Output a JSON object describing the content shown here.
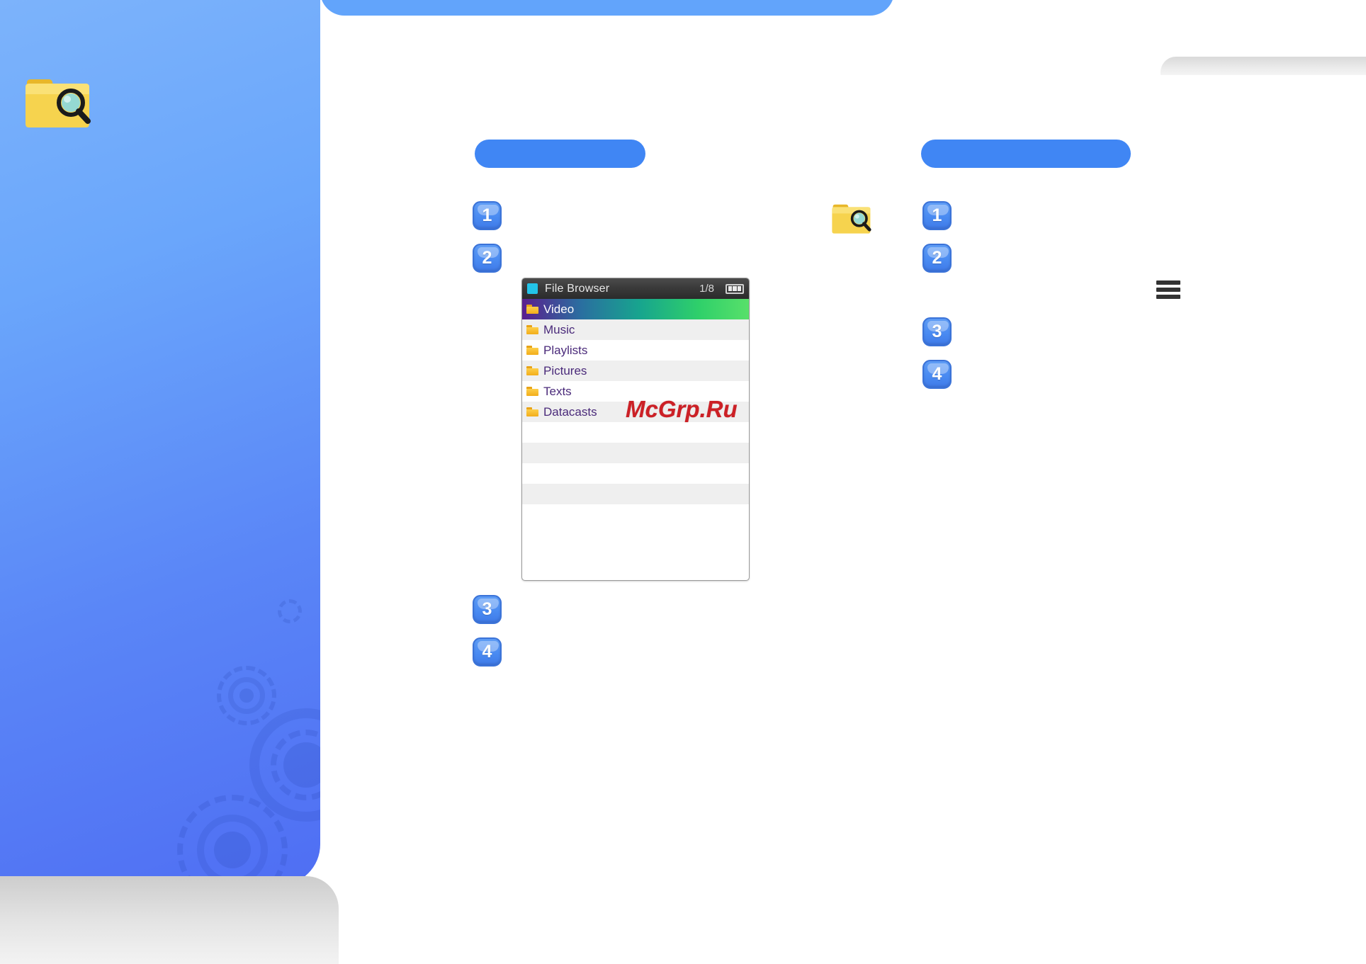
{
  "page": {
    "background_color": "#ffffff",
    "left_panel_color": "#5a86f7",
    "accent_color": "#4086f4"
  },
  "icons": {
    "folder_search_large": "folder-search-icon",
    "folder_search_small": "folder-search-icon",
    "menu": "hamburger-menu-icon"
  },
  "sections": {
    "left": {
      "heading_label": "",
      "steps": [
        {
          "number": "1"
        },
        {
          "number": "2"
        },
        {
          "number": "3"
        },
        {
          "number": "4"
        }
      ]
    },
    "right": {
      "heading_label": "",
      "steps": [
        {
          "number": "1"
        },
        {
          "number": "2"
        },
        {
          "number": "3"
        },
        {
          "number": "4"
        }
      ]
    }
  },
  "device_screen": {
    "title": "File Browser",
    "page_indicator": "1/8",
    "battery": "battery-icon",
    "items": [
      {
        "label": "Video",
        "selected": true
      },
      {
        "label": "Music",
        "selected": false
      },
      {
        "label": "Playlists",
        "selected": false
      },
      {
        "label": "Pictures",
        "selected": false
      },
      {
        "label": "Texts",
        "selected": false
      },
      {
        "label": "Datacasts",
        "selected": false
      }
    ],
    "empty_rows": 5
  },
  "watermark": {
    "text": "McGrp.Ru",
    "color": "#cc2026"
  }
}
